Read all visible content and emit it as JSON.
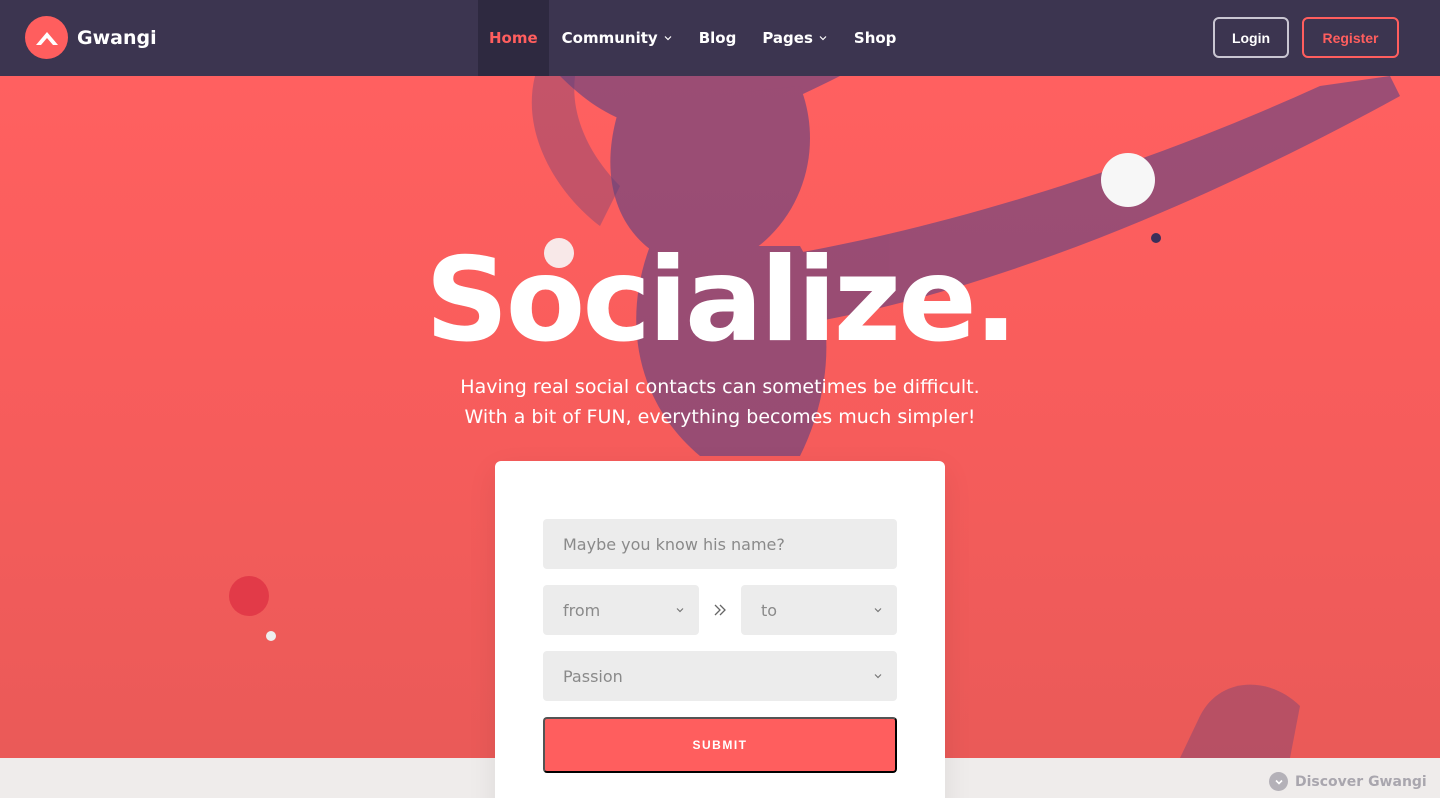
{
  "brand": {
    "name": "Gwangi",
    "accent": "#ff5e5e",
    "nav_bg": "#3c3550"
  },
  "nav": {
    "items": [
      {
        "label": "Home",
        "active": true,
        "dropdown": false
      },
      {
        "label": "Community",
        "active": false,
        "dropdown": true
      },
      {
        "label": "Blog",
        "active": false,
        "dropdown": false
      },
      {
        "label": "Pages",
        "active": false,
        "dropdown": true
      },
      {
        "label": "Shop",
        "active": false,
        "dropdown": false
      }
    ],
    "login_label": "Login",
    "register_label": "Register"
  },
  "hero": {
    "title": "Socialize.",
    "subtitle_line1": "Having real social contacts can sometimes be difficult.",
    "subtitle_line2": "With a bit of FUN, everything becomes much simpler!"
  },
  "search_form": {
    "name_placeholder": "Maybe you know his name?",
    "from_value": "from",
    "to_value": "to",
    "passion_value": "Passion",
    "submit_label": "SUBMIT",
    "range_icon": "double-chevron-right-icon"
  },
  "footer_hint": {
    "label": "Discover Gwangi",
    "icon": "chevron-down-circle-icon"
  }
}
